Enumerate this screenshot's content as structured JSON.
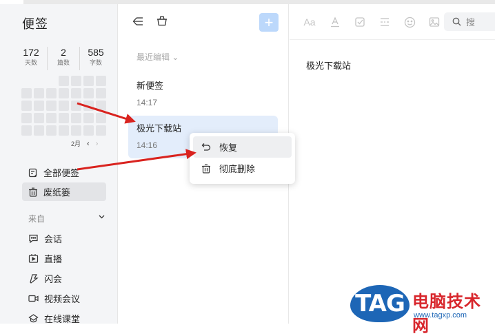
{
  "sidebar": {
    "title": "便签",
    "stats": [
      {
        "value": "172",
        "label": "天数"
      },
      {
        "value": "2",
        "label": "篇数"
      },
      {
        "value": "585",
        "label": "字数"
      }
    ],
    "calendar": {
      "month": "2月"
    },
    "nav": [
      {
        "label": "全部便签",
        "icon": "note-list-icon"
      },
      {
        "label": "废纸篓",
        "icon": "trash-icon",
        "active": true
      }
    ],
    "source_header": "来自",
    "sources": [
      {
        "label": "会话",
        "icon": "chat-icon"
      },
      {
        "label": "直播",
        "icon": "live-icon"
      },
      {
        "label": "闪会",
        "icon": "flash-meeting-icon"
      },
      {
        "label": "视频会议",
        "icon": "video-icon"
      },
      {
        "label": "在线课堂",
        "icon": "classroom-icon"
      }
    ]
  },
  "list": {
    "sort_label": "最近编辑",
    "notes": [
      {
        "title": "新便签",
        "time": "14:17"
      },
      {
        "title": "极光下载站",
        "time": "14:16",
        "selected": true
      }
    ]
  },
  "context_menu": {
    "items": [
      {
        "label": "恢复",
        "icon": "restore-icon"
      },
      {
        "label": "彻底删除",
        "icon": "trash-icon"
      }
    ]
  },
  "editor": {
    "toolbar": [
      "font-size-icon",
      "text-color-icon",
      "checkbox-icon",
      "divider-icon",
      "emoji-icon",
      "image-icon"
    ],
    "search_placeholder": "搜",
    "content": "极光下载站"
  },
  "watermark": {
    "logo": "TAG",
    "name": "电脑技术网",
    "url": "www.tagxp.com"
  },
  "colors": {
    "accent_light": "#bcd8fb",
    "selected_bg": "#e3edfb",
    "arrow": "#d9231f"
  }
}
